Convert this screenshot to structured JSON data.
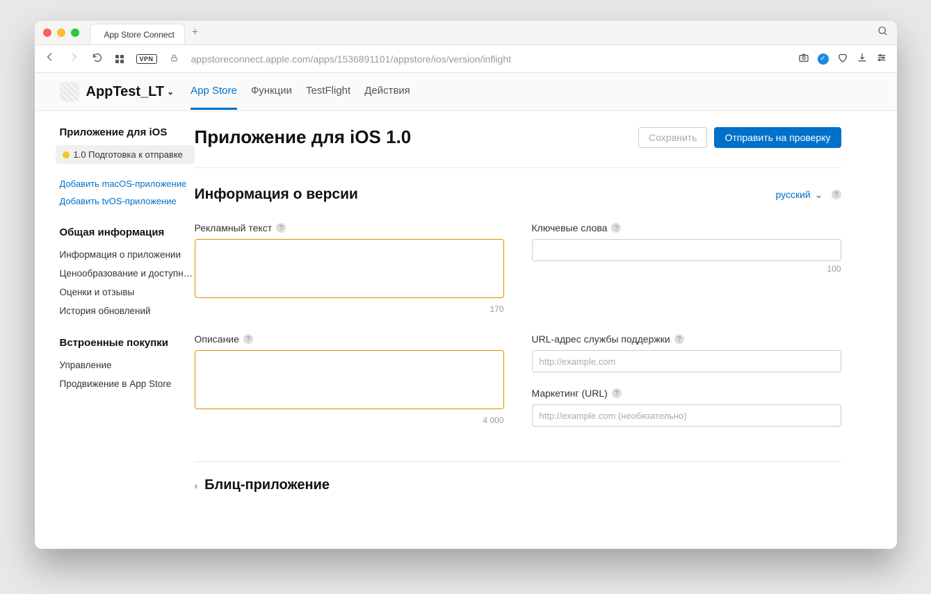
{
  "browser": {
    "tab_title": "App Store Connect",
    "url": "appstoreconnect.apple.com/apps/1536891101/appstore/ios/version/inflight",
    "vpn_label": "VPN"
  },
  "header": {
    "app_name": "AppTest_LT",
    "tabs": [
      "App Store",
      "Функции",
      "TestFlight",
      "Действия"
    ]
  },
  "sidebar": {
    "section1_title": "Приложение для iOS",
    "version_status": "1.0 Подготовка к отправке",
    "add_macos": "Добавить macOS-приложение",
    "add_tvos": "Добавить tvOS-приложение",
    "section2_title": "Общая информация",
    "general_items": [
      "Информация о приложении",
      "Ценообразование и доступно…",
      "Оценки и отзывы",
      "История обновлений"
    ],
    "section3_title": "Встроенные покупки",
    "iap_items": [
      "Управление",
      "Продвижение в App Store"
    ]
  },
  "main": {
    "page_title": "Приложение для iOS 1.0",
    "save_label": "Сохранить",
    "submit_label": "Отправить на проверку",
    "section_title": "Информация о версии",
    "language": "русский",
    "fields": {
      "promo_label": "Рекламный текст",
      "promo_counter": "170",
      "keywords_label": "Ключевые слова",
      "keywords_counter": "100",
      "desc_label": "Описание",
      "desc_counter": "4 000",
      "support_url_label": "URL-адрес службы поддержки",
      "support_url_placeholder": "http://example.com",
      "marketing_url_label": "Маркетинг (URL)",
      "marketing_url_placeholder": "http://example.com (необязательно)"
    },
    "collapse_title": "Блиц-приложение"
  }
}
